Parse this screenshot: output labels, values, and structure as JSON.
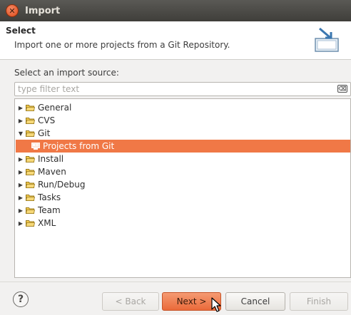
{
  "window": {
    "title": "Import",
    "close_icon": "close-icon"
  },
  "header": {
    "title": "Select",
    "description": "Import one or more projects from a Git Repository.",
    "icon": "import-wizard-icon"
  },
  "source_label": "Select an import source:",
  "filter": {
    "placeholder": "type filter text",
    "value": "",
    "clear_icon": "clear-filter-icon"
  },
  "tree": {
    "items": [
      {
        "label": "General",
        "expanded": false
      },
      {
        "label": "CVS",
        "expanded": false
      },
      {
        "label": "Git",
        "expanded": true
      },
      {
        "label": "Projects from Git",
        "child": true,
        "selected": true
      },
      {
        "label": "Install",
        "expanded": false
      },
      {
        "label": "Maven",
        "expanded": false
      },
      {
        "label": "Run/Debug",
        "expanded": false
      },
      {
        "label": "Tasks",
        "expanded": false
      },
      {
        "label": "Team",
        "expanded": false
      },
      {
        "label": "XML",
        "expanded": false
      }
    ]
  },
  "buttons": {
    "back": "< Back",
    "next": "Next >",
    "cancel": "Cancel",
    "finish": "Finish",
    "help": "?"
  },
  "colors": {
    "selection": "#f07846",
    "titlebar": "#3f3e3a",
    "accent": "#ea6a3a"
  }
}
